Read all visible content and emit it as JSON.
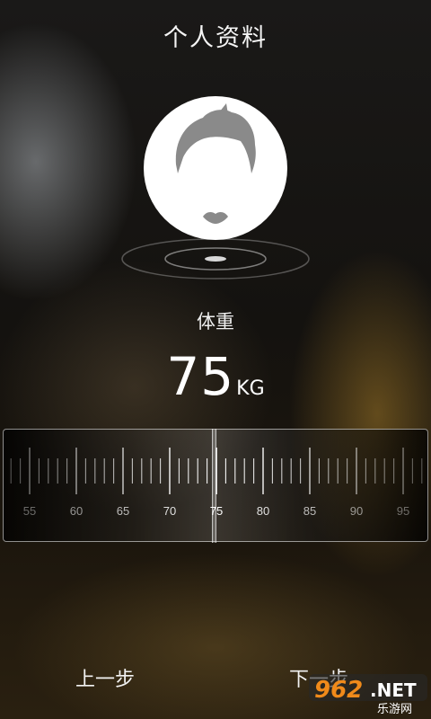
{
  "header": {
    "title": "个人资料"
  },
  "avatar": {
    "icon": "male-head-silhouette-icon"
  },
  "weight": {
    "label": "体重",
    "value": "75",
    "unit": "KG"
  },
  "ruler": {
    "min": 53,
    "max": 97,
    "selected": 75,
    "labels": [
      "55",
      "60",
      "65",
      "70",
      "75",
      "80",
      "85",
      "90",
      "95"
    ]
  },
  "nav": {
    "prev_label": "上一步",
    "next_label": "下一步"
  },
  "watermark": {
    "brand": "962",
    "suffix": ".NET",
    "subtitle": "乐游网"
  }
}
